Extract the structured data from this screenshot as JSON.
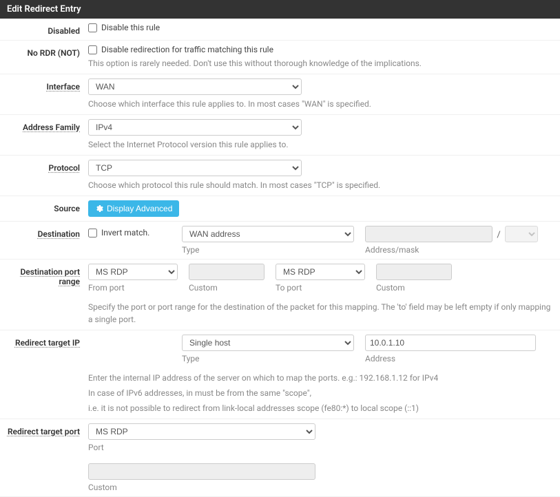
{
  "panel": {
    "title": "Edit Redirect Entry"
  },
  "rows": {
    "disabled": {
      "label": "Disabled",
      "checkbox_label": "Disable this rule"
    },
    "nordr": {
      "label": "No RDR (NOT)",
      "checkbox_label": "Disable redirection for traffic matching this rule",
      "help": "This option is rarely needed. Don't use this without thorough knowledge of the implications."
    },
    "interface": {
      "label": "Interface",
      "value": "WAN",
      "help": "Choose which interface this rule applies to. In most cases \"WAN\" is specified."
    },
    "addrfam": {
      "label": "Address Family",
      "value": "IPv4",
      "help": "Select the Internet Protocol version this rule applies to."
    },
    "protocol": {
      "label": "Protocol",
      "value": "TCP",
      "help": "Choose which protocol this rule should match. In most cases \"TCP\" is specified."
    },
    "source": {
      "label": "Source",
      "button": "Display Advanced"
    },
    "destination": {
      "label": "Destination",
      "invert_label": "Invert match.",
      "type_value": "WAN address",
      "type_sub": "Type",
      "mask_slash": "/",
      "mask_sub": "Address/mask"
    },
    "destport": {
      "label": "Destination port range",
      "from_value": "MS RDP",
      "from_sub": "From port",
      "custom1_sub": "Custom",
      "to_value": "MS RDP",
      "to_sub": "To port",
      "custom2_sub": "Custom",
      "help": "Specify the port or port range for the destination of the packet for this mapping. The 'to' field may be left empty if only mapping a single port."
    },
    "redirip": {
      "label": "Redirect target IP",
      "type_value": "Single host",
      "type_sub": "Type",
      "addr_value": "10.0.1.10",
      "addr_sub": "Address",
      "help1": "Enter the internal IP address of the server on which to map the ports. e.g.: 192.168.1.12 for IPv4",
      "help2": "In case of IPv6 addresses, in must be from the same \"scope\",",
      "help3": "i.e. it is not possible to redirect from link-local addresses scope (fe80:*) to local scope (::1)"
    },
    "redirport": {
      "label": "Redirect target port",
      "port_value": "MS RDP",
      "port_sub": "Port",
      "custom_sub": "Custom"
    }
  }
}
